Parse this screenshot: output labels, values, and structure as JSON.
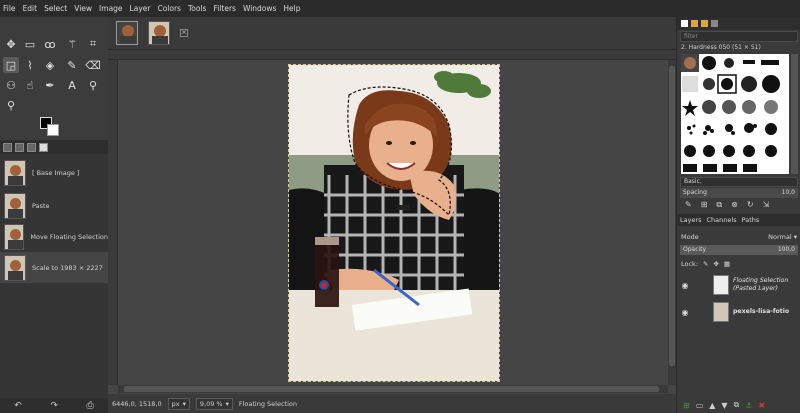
{
  "menu": [
    "File",
    "Edit",
    "Select",
    "View",
    "Image",
    "Layer",
    "Colors",
    "Tools",
    "Filters",
    "Windows",
    "Help"
  ],
  "undo_history": [
    {
      "label": "[ Base Image ]"
    },
    {
      "label": "Paste"
    },
    {
      "label": "Move Floating Selection"
    },
    {
      "label": "Scale to 1983 × 2227"
    }
  ],
  "status": {
    "coords": "6446,0, 1518,0",
    "unit": "px",
    "zoom": "9,09 %",
    "message": "Floating Selection"
  },
  "brushes": {
    "filter_placeholder": "filter",
    "selected_brush": "2. Hardness 050 (51 × 51)",
    "preset": "Basic,",
    "spacing_label": "Spacing",
    "spacing_value": "10,0"
  },
  "layers_panel": {
    "tabs": [
      "Layers",
      "Channels",
      "Paths"
    ],
    "mode_label": "Mode",
    "mode_value": "Normal",
    "opacity_label": "Opacity",
    "opacity_value": "100,0",
    "lock_label": "Lock:",
    "layers": [
      {
        "name_line1": "Floating Selection",
        "name_line2": "(Pasted Layer)"
      },
      {
        "name_line1": "pexels-lisa-fotio",
        "name_line2": ""
      }
    ]
  },
  "colors": {
    "accent_green": "#3f9a3a",
    "accent_red": "#c23a3a"
  }
}
